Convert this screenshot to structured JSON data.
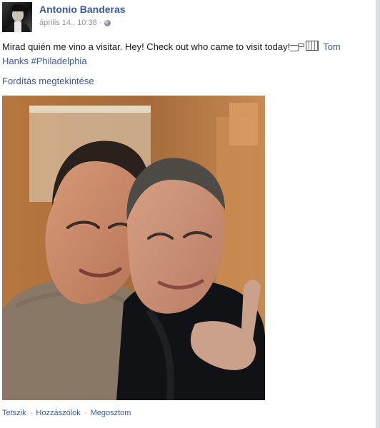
{
  "post": {
    "author": "Antonio Banderas",
    "date": "április 14., 10:38",
    "meta_separator": "·",
    "text_main": "Mirad quién me vino a visitar. Hey! Check out who came to visit today!",
    "tag_tom": "Tom",
    "tag_hanks": "Hanks",
    "hashtag": "#Philadelphia",
    "translate_label": "Fordítás megtekintése",
    "photo_description": "selfie-two-men"
  },
  "actions": {
    "like": "Tetszik",
    "comment": "Hozzászólok",
    "share": "Megosztom",
    "separator": "·"
  },
  "icons": {
    "avatar": "profile-photo",
    "privacy": "globe-icon",
    "emoji_point": "pointing-hand-icon",
    "emoji_box": "emoji-box-icon"
  },
  "colors": {
    "link": "#3b5998",
    "meta": "#90949c",
    "text": "#141823"
  }
}
